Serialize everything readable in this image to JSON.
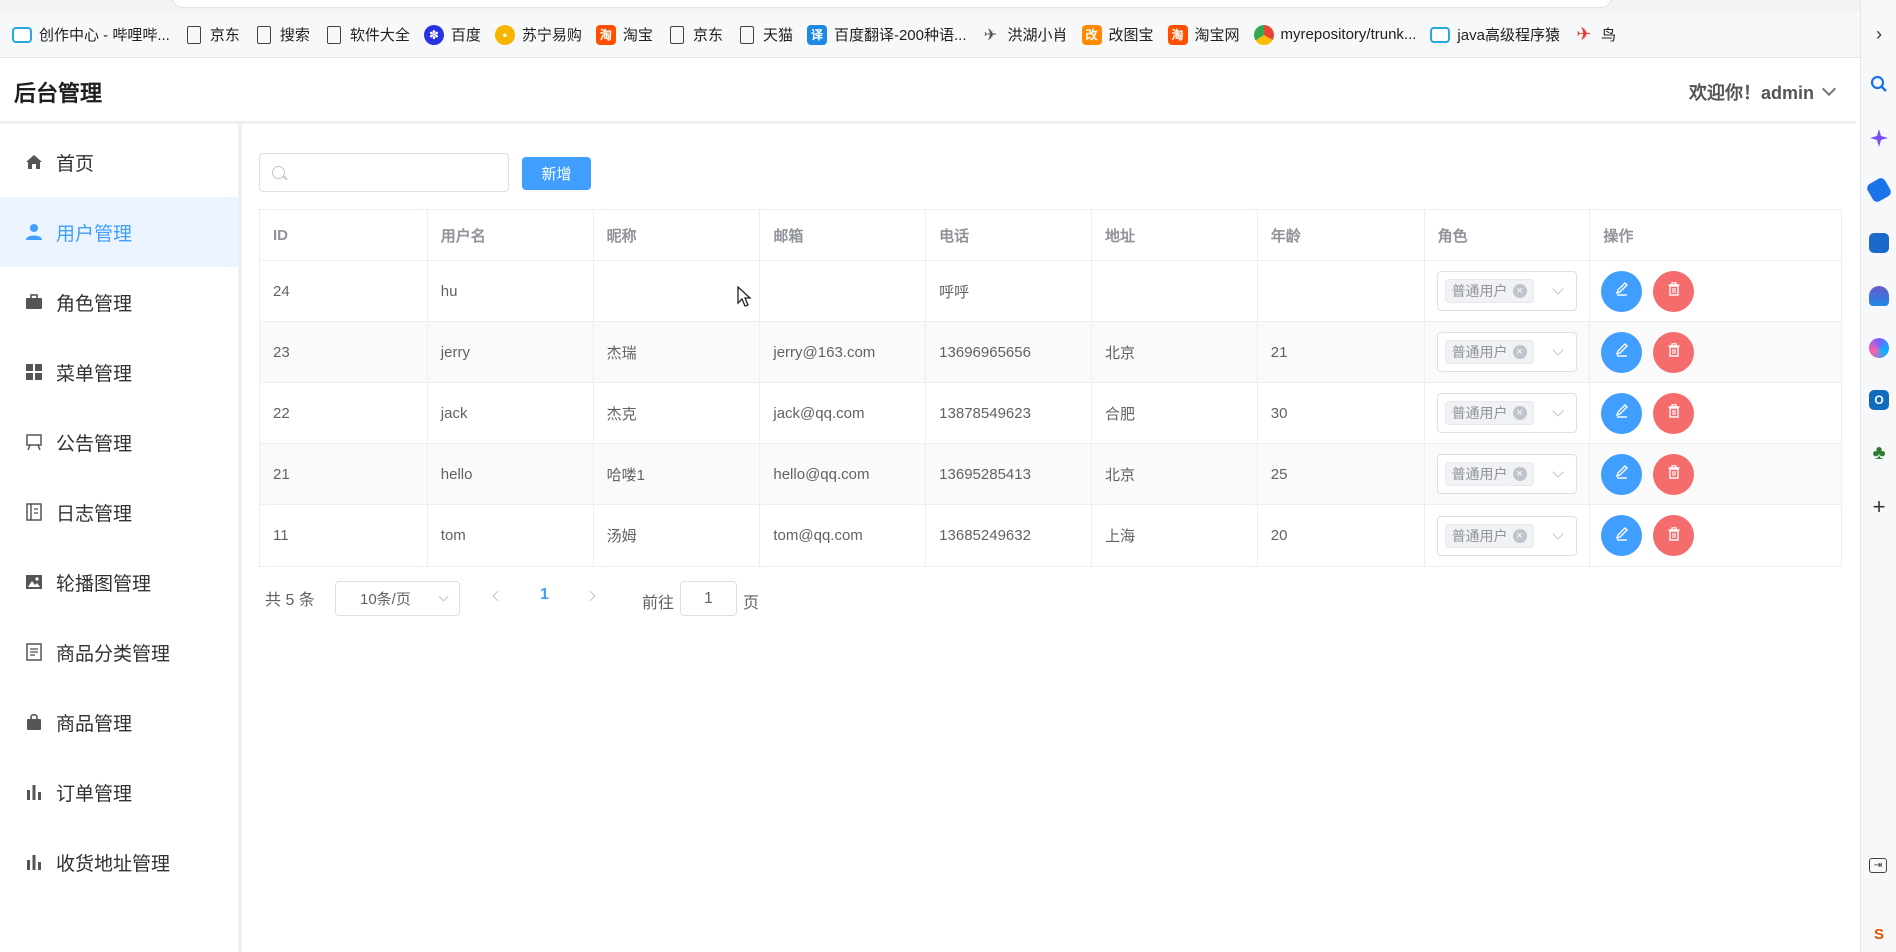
{
  "bookmarks": [
    {
      "label": "创作中心 - 哔哩哔...",
      "icon": "bilibili-icon"
    },
    {
      "label": "京东",
      "icon": "page-icon"
    },
    {
      "label": "搜索",
      "icon": "page-icon"
    },
    {
      "label": "软件大全",
      "icon": "page-icon"
    },
    {
      "label": "百度",
      "icon": "baidu-icon"
    },
    {
      "label": "苏宁易购",
      "icon": "suning-icon"
    },
    {
      "label": "淘宝",
      "icon": "taobao-icon"
    },
    {
      "label": "京东",
      "icon": "page-icon"
    },
    {
      "label": "天猫",
      "icon": "page-icon"
    },
    {
      "label": "百度翻译-200种语...",
      "icon": "translate-icon"
    },
    {
      "label": "洪湖小肖",
      "icon": "bird-icon"
    },
    {
      "label": "改图宝",
      "icon": "gaitubao-icon"
    },
    {
      "label": "淘宝网",
      "icon": "taobao-icon"
    },
    {
      "label": "myrepository/trunk...",
      "icon": "chrome-icon"
    },
    {
      "label": "java高级程序猿",
      "icon": "bilibili-icon"
    },
    {
      "label": "鸟",
      "icon": "red-bird-icon"
    }
  ],
  "header": {
    "title": "后台管理",
    "welcome": "欢迎你！admin"
  },
  "sidebar": {
    "items": [
      {
        "label": "首页",
        "icon": "home-icon",
        "active": false
      },
      {
        "label": "用户管理",
        "icon": "user-icon",
        "active": true
      },
      {
        "label": "角色管理",
        "icon": "briefcase-icon",
        "active": false
      },
      {
        "label": "菜单管理",
        "icon": "grid-icon",
        "active": false
      },
      {
        "label": "公告管理",
        "icon": "easel-icon",
        "active": false
      },
      {
        "label": "日志管理",
        "icon": "notebook-icon",
        "active": false
      },
      {
        "label": "轮播图管理",
        "icon": "picture-icon",
        "active": false
      },
      {
        "label": "商品分类管理",
        "icon": "document-icon",
        "active": false
      },
      {
        "label": "商品管理",
        "icon": "shopping-bag-icon",
        "active": false
      },
      {
        "label": "订单管理",
        "icon": "bar-chart-icon",
        "active": false
      },
      {
        "label": "收货地址管理",
        "icon": "bar-chart-icon",
        "active": false
      }
    ]
  },
  "toolbar": {
    "search_value": "",
    "search_placeholder": "",
    "add_label": "新增"
  },
  "table": {
    "columns": [
      "ID",
      "用户名",
      "昵称",
      "邮箱",
      "电话",
      "地址",
      "年龄",
      "角色",
      "操作"
    ],
    "rows": [
      {
        "id": "24",
        "username": "hu",
        "nickname": "",
        "email": "",
        "phone": "呼呼",
        "address": "",
        "age": "",
        "role": "普通用户"
      },
      {
        "id": "23",
        "username": "jerry",
        "nickname": "杰瑞",
        "email": "jerry@163.com",
        "phone": "13696965656",
        "address": "北京",
        "age": "21",
        "role": "普通用户"
      },
      {
        "id": "22",
        "username": "jack",
        "nickname": "杰克",
        "email": "jack@qq.com",
        "phone": "13878549623",
        "address": "合肥",
        "age": "30",
        "role": "普通用户"
      },
      {
        "id": "21",
        "username": "hello",
        "nickname": "哈喽1",
        "email": "hello@qq.com",
        "phone": "13695285413",
        "address": "北京",
        "age": "25",
        "role": "普通用户"
      },
      {
        "id": "11",
        "username": "tom",
        "nickname": "汤姆",
        "email": "tom@qq.com",
        "phone": "13685249632",
        "address": "上海",
        "age": "20",
        "role": "普通用户"
      }
    ]
  },
  "pagination": {
    "total_label": "共 5 条",
    "page_size": "10条/页",
    "current_page": "1",
    "goto_label": "前往",
    "goto_value": "1",
    "goto_suffix": "页"
  },
  "colors": {
    "primary": "#409eff",
    "danger": "#f56c6c",
    "active_bg": "#ecf5ff"
  }
}
